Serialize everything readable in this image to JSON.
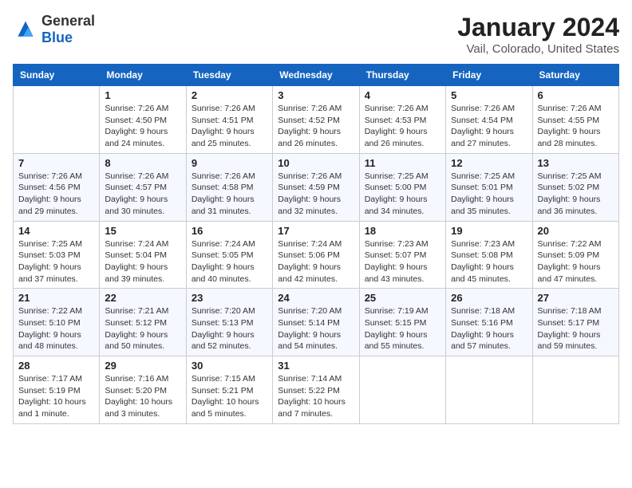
{
  "header": {
    "logo": {
      "general": "General",
      "blue": "Blue"
    },
    "title": "January 2024",
    "location": "Vail, Colorado, United States"
  },
  "calendar": {
    "days_of_week": [
      "Sunday",
      "Monday",
      "Tuesday",
      "Wednesday",
      "Thursday",
      "Friday",
      "Saturday"
    ],
    "weeks": [
      [
        {
          "day": "",
          "info": ""
        },
        {
          "day": "1",
          "info": "Sunrise: 7:26 AM\nSunset: 4:50 PM\nDaylight: 9 hours\nand 24 minutes."
        },
        {
          "day": "2",
          "info": "Sunrise: 7:26 AM\nSunset: 4:51 PM\nDaylight: 9 hours\nand 25 minutes."
        },
        {
          "day": "3",
          "info": "Sunrise: 7:26 AM\nSunset: 4:52 PM\nDaylight: 9 hours\nand 26 minutes."
        },
        {
          "day": "4",
          "info": "Sunrise: 7:26 AM\nSunset: 4:53 PM\nDaylight: 9 hours\nand 26 minutes."
        },
        {
          "day": "5",
          "info": "Sunrise: 7:26 AM\nSunset: 4:54 PM\nDaylight: 9 hours\nand 27 minutes."
        },
        {
          "day": "6",
          "info": "Sunrise: 7:26 AM\nSunset: 4:55 PM\nDaylight: 9 hours\nand 28 minutes."
        }
      ],
      [
        {
          "day": "7",
          "info": "Sunrise: 7:26 AM\nSunset: 4:56 PM\nDaylight: 9 hours\nand 29 minutes."
        },
        {
          "day": "8",
          "info": "Sunrise: 7:26 AM\nSunset: 4:57 PM\nDaylight: 9 hours\nand 30 minutes."
        },
        {
          "day": "9",
          "info": "Sunrise: 7:26 AM\nSunset: 4:58 PM\nDaylight: 9 hours\nand 31 minutes."
        },
        {
          "day": "10",
          "info": "Sunrise: 7:26 AM\nSunset: 4:59 PM\nDaylight: 9 hours\nand 32 minutes."
        },
        {
          "day": "11",
          "info": "Sunrise: 7:25 AM\nSunset: 5:00 PM\nDaylight: 9 hours\nand 34 minutes."
        },
        {
          "day": "12",
          "info": "Sunrise: 7:25 AM\nSunset: 5:01 PM\nDaylight: 9 hours\nand 35 minutes."
        },
        {
          "day": "13",
          "info": "Sunrise: 7:25 AM\nSunset: 5:02 PM\nDaylight: 9 hours\nand 36 minutes."
        }
      ],
      [
        {
          "day": "14",
          "info": "Sunrise: 7:25 AM\nSunset: 5:03 PM\nDaylight: 9 hours\nand 37 minutes."
        },
        {
          "day": "15",
          "info": "Sunrise: 7:24 AM\nSunset: 5:04 PM\nDaylight: 9 hours\nand 39 minutes."
        },
        {
          "day": "16",
          "info": "Sunrise: 7:24 AM\nSunset: 5:05 PM\nDaylight: 9 hours\nand 40 minutes."
        },
        {
          "day": "17",
          "info": "Sunrise: 7:24 AM\nSunset: 5:06 PM\nDaylight: 9 hours\nand 42 minutes."
        },
        {
          "day": "18",
          "info": "Sunrise: 7:23 AM\nSunset: 5:07 PM\nDaylight: 9 hours\nand 43 minutes."
        },
        {
          "day": "19",
          "info": "Sunrise: 7:23 AM\nSunset: 5:08 PM\nDaylight: 9 hours\nand 45 minutes."
        },
        {
          "day": "20",
          "info": "Sunrise: 7:22 AM\nSunset: 5:09 PM\nDaylight: 9 hours\nand 47 minutes."
        }
      ],
      [
        {
          "day": "21",
          "info": "Sunrise: 7:22 AM\nSunset: 5:10 PM\nDaylight: 9 hours\nand 48 minutes."
        },
        {
          "day": "22",
          "info": "Sunrise: 7:21 AM\nSunset: 5:12 PM\nDaylight: 9 hours\nand 50 minutes."
        },
        {
          "day": "23",
          "info": "Sunrise: 7:20 AM\nSunset: 5:13 PM\nDaylight: 9 hours\nand 52 minutes."
        },
        {
          "day": "24",
          "info": "Sunrise: 7:20 AM\nSunset: 5:14 PM\nDaylight: 9 hours\nand 54 minutes."
        },
        {
          "day": "25",
          "info": "Sunrise: 7:19 AM\nSunset: 5:15 PM\nDaylight: 9 hours\nand 55 minutes."
        },
        {
          "day": "26",
          "info": "Sunrise: 7:18 AM\nSunset: 5:16 PM\nDaylight: 9 hours\nand 57 minutes."
        },
        {
          "day": "27",
          "info": "Sunrise: 7:18 AM\nSunset: 5:17 PM\nDaylight: 9 hours\nand 59 minutes."
        }
      ],
      [
        {
          "day": "28",
          "info": "Sunrise: 7:17 AM\nSunset: 5:19 PM\nDaylight: 10 hours\nand 1 minute."
        },
        {
          "day": "29",
          "info": "Sunrise: 7:16 AM\nSunset: 5:20 PM\nDaylight: 10 hours\nand 3 minutes."
        },
        {
          "day": "30",
          "info": "Sunrise: 7:15 AM\nSunset: 5:21 PM\nDaylight: 10 hours\nand 5 minutes."
        },
        {
          "day": "31",
          "info": "Sunrise: 7:14 AM\nSunset: 5:22 PM\nDaylight: 10 hours\nand 7 minutes."
        },
        {
          "day": "",
          "info": ""
        },
        {
          "day": "",
          "info": ""
        },
        {
          "day": "",
          "info": ""
        }
      ]
    ]
  }
}
